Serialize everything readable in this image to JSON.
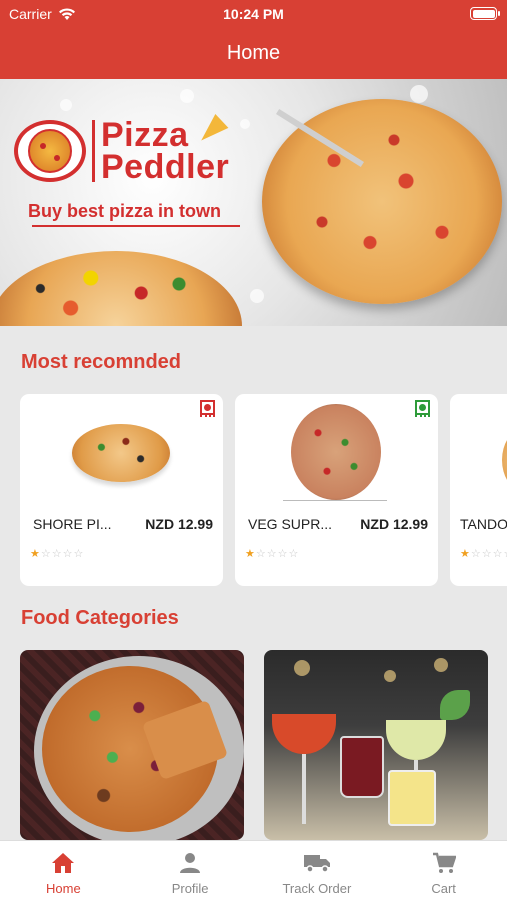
{
  "status_bar": {
    "carrier": "Carrier",
    "time": "10:24 PM"
  },
  "nav": {
    "title": "Home"
  },
  "banner": {
    "logo_line1": "Pizza",
    "logo_line2": "Peddler",
    "tagline": "Buy best pizza in town"
  },
  "sections": {
    "recommended_title": "Most recomnded",
    "categories_title": "Food Categories"
  },
  "recommended": [
    {
      "name": "SHORE PI...",
      "price": "NZD 12.99",
      "rating": 1,
      "max_rating": 5,
      "veg": false,
      "indicator_color": "#d32f2f"
    },
    {
      "name": "VEG SUPR...",
      "price": "NZD 12.99",
      "rating": 1,
      "max_rating": 5,
      "veg": true,
      "indicator_color": "#2e9b3a"
    },
    {
      "name": "TANDO",
      "price": "",
      "rating": 1,
      "max_rating": 5,
      "veg": false,
      "indicator_color": "#d32f2f"
    }
  ],
  "categories": [
    {
      "image": "pizza-category-image"
    },
    {
      "image": "drinks-category-image"
    }
  ],
  "tabs": [
    {
      "label": "Home",
      "icon": "home-icon",
      "active": true
    },
    {
      "label": "Profile",
      "icon": "profile-icon",
      "active": false
    },
    {
      "label": "Track Order",
      "icon": "truck-icon",
      "active": false
    },
    {
      "label": "Cart",
      "icon": "cart-icon",
      "active": false
    }
  ],
  "colors": {
    "primary": "#d84034",
    "star": "#f0a020",
    "background": "#e8e8e8"
  }
}
